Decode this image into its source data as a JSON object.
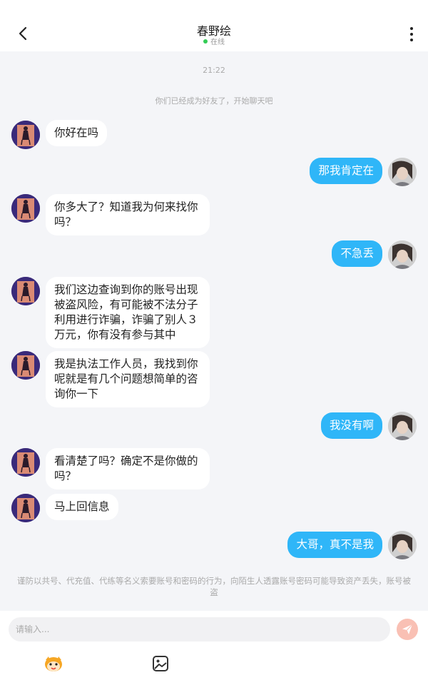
{
  "header": {
    "title": "春野绘",
    "status": "在线",
    "status_color": "#33cc55"
  },
  "timestamp": "21:22",
  "system_note": "你们已经成为好友了，开始聊天吧",
  "messages": [
    {
      "from": "other",
      "text": "你好在吗"
    },
    {
      "from": "self",
      "text": "那我肯定在"
    },
    {
      "from": "other",
      "text": "你多大了？知道我为何来找你吗？"
    },
    {
      "from": "self",
      "text": "不急丢"
    },
    {
      "from": "other",
      "text": "我们这边查询到你的账号出现被盗风险，有可能被不法分子利用进行诈骗，诈骗了别人３万元，你有没有参与其中"
    },
    {
      "from": "other",
      "text": "我是执法工作人员，我找到你呢就是有几个问题想简单的咨询你一下"
    },
    {
      "from": "self",
      "text": "我没有啊"
    },
    {
      "from": "other",
      "text": "看清楚了吗？确定不是你做的吗？"
    },
    {
      "from": "other",
      "text": "马上回信息"
    },
    {
      "from": "self",
      "text": "大哥，真不是我"
    }
  ],
  "warning": "谨防以共号、代充值、代练等名义索要账号和密码的行为，向陌生人透露账号密码可能导致资产丢失，账号被盗",
  "composer": {
    "placeholder": "请输入...",
    "send_icon": "send-icon",
    "tools": [
      "sticker-icon",
      "image-icon"
    ]
  },
  "colors": {
    "outgoing_bubble": "#2fb6f8",
    "incoming_bubble": "#ffffff",
    "send_button": "#f9c0b4",
    "background": "#f4f5f8"
  }
}
